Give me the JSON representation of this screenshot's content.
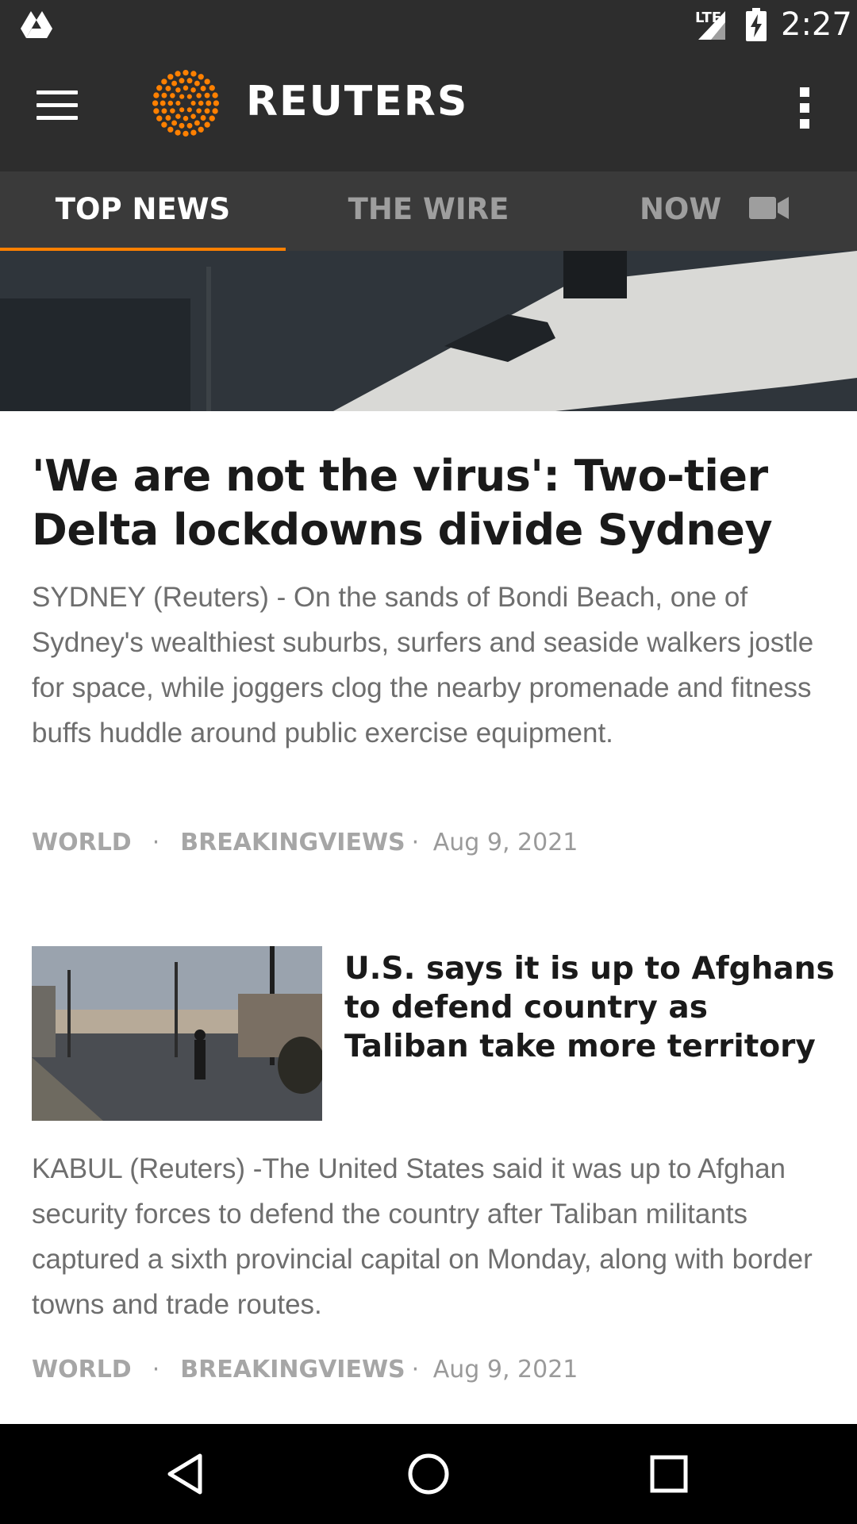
{
  "status_bar": {
    "network": "LTE",
    "time": "2:27",
    "icons": [
      "drive-icon",
      "signal-icon",
      "battery-charging-icon"
    ]
  },
  "app_bar": {
    "logo_text": "REUTERS",
    "icons": [
      "menu-icon",
      "reuters-logo-icon",
      "overflow-menu-icon"
    ],
    "accent_color": "#ff8000"
  },
  "tabs": [
    {
      "label": "TOP NEWS",
      "active": true
    },
    {
      "label": "THE WIRE",
      "active": false
    },
    {
      "label": "NOW",
      "active": false,
      "icon": "video-camera-icon"
    }
  ],
  "articles": [
    {
      "headline": "'We are not the virus': Two-tier Delta lockdowns divide Sydney",
      "summary": "SYDNEY (Reuters) -     On the sands of Bondi Beach, one of Sydney's wealthiest suburbs, surfers and seaside walkers jostle for space, while joggers clog the nearby promenade and fitness buffs huddle around public exercise equipment.",
      "tags": [
        "WORLD",
        "BREAKINGVIEWS"
      ],
      "date": "Aug 9, 2021"
    },
    {
      "headline": "U.S. says it is up to Afghans to defend country as Taliban take more territory",
      "summary": "KABUL (Reuters) -The United States said it was up to Afghan security forces to defend the country after Taliban militants captured a sixth provincial capital on Monday, along with border towns and trade routes.",
      "tags": [
        "WORLD",
        "BREAKINGVIEWS"
      ],
      "date": "Aug 9, 2021"
    }
  ],
  "nav_bar": {
    "icons": [
      "back-icon",
      "home-icon",
      "recents-icon"
    ]
  }
}
